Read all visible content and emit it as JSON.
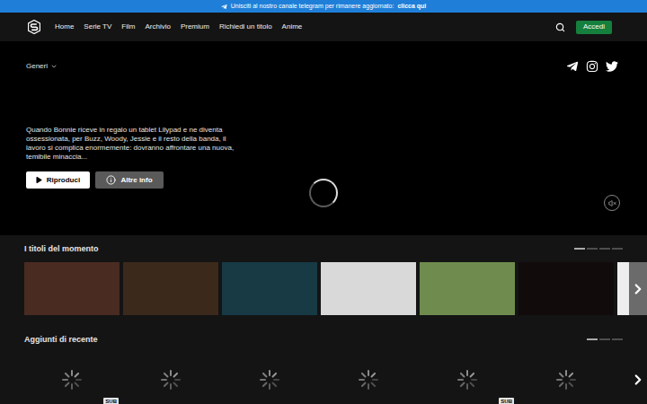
{
  "banner": {
    "text": "Unisciti al nostro canale telegram per rimanere aggiornato:",
    "link": "clicca qui"
  },
  "nav": {
    "items": [
      {
        "label": "Home",
        "selected": false
      },
      {
        "label": "Serie TV",
        "selected": false
      },
      {
        "label": "Film",
        "selected": false
      },
      {
        "label": "Archivio",
        "selected": false
      },
      {
        "label": "Premium",
        "selected": false
      },
      {
        "label": "Richiedi un titolo",
        "selected": false
      },
      {
        "label": "Anime",
        "selected": false
      }
    ],
    "login_button": "Accedi"
  },
  "hero": {
    "genres_label": "Generi",
    "description": "Quando Bonnie riceve in regalo un tablet Lilypad e ne diventa ossessionata, per Buzz, Woody, Jessie e il resto della banda, il lavoro si complica enormemente: dovranno affrontare una nuova, temibile minaccia...",
    "buttons": [
      {
        "label": "Riproduci",
        "kind": "primary"
      },
      {
        "label": "Altre info",
        "kind": "secondary"
      }
    ],
    "loading": true,
    "muted": true
  },
  "trending": {
    "title": "I titoli del momento",
    "pages": [
      {
        "selected": true
      },
      {
        "selected": false
      },
      {
        "selected": false
      },
      {
        "selected": false
      }
    ],
    "cards": [
      {
        "color": "#4a2b22"
      },
      {
        "color": "#3b2a1c"
      },
      {
        "color": "#173a45"
      },
      {
        "color": "#d9d9d9"
      },
      {
        "color": "#6f8c4e"
      },
      {
        "color": "#120b0b"
      },
      {
        "color": "#eeeeee"
      }
    ]
  },
  "recent": {
    "title": "Aggiunti di recente",
    "sub_label": "SUB",
    "pages": [
      {
        "selected": true
      },
      {
        "selected": false
      },
      {
        "selected": false
      }
    ],
    "cards": [
      {
        "loading": true,
        "sub": true
      },
      {
        "loading": true,
        "sub": false
      },
      {
        "loading": true,
        "sub": false
      },
      {
        "loading": true,
        "sub": false
      },
      {
        "loading": true,
        "sub": true
      },
      {
        "loading": true,
        "sub": false
      }
    ]
  }
}
